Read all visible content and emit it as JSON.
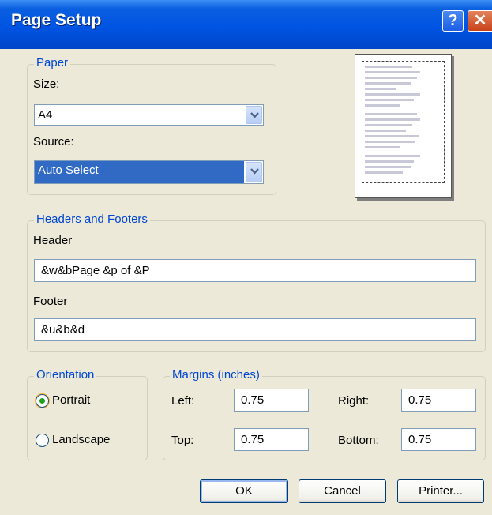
{
  "dialog": {
    "title": "Page Setup",
    "help_glyph": "?",
    "close_glyph": "✕"
  },
  "paper": {
    "legend": "Paper",
    "size_label": "Size:",
    "size_value": "A4",
    "source_label": "Source:",
    "source_value": "Auto Select"
  },
  "headers_footers": {
    "legend": "Headers and Footers",
    "header_label": "Header",
    "header_value": "&w&bPage &p of &P",
    "footer_label": "Footer",
    "footer_value": "&u&b&d"
  },
  "orientation": {
    "legend": "Orientation",
    "portrait_label": "Portrait",
    "landscape_label": "Landscape",
    "selected": "Portrait"
  },
  "margins": {
    "legend": "Margins (inches)",
    "left_label": "Left:",
    "left_value": "0.75",
    "right_label": "Right:",
    "right_value": "0.75",
    "top_label": "Top:",
    "top_value": "0.75",
    "bottom_label": "Bottom:",
    "bottom_value": "0.75"
  },
  "buttons": {
    "ok": "OK",
    "cancel": "Cancel",
    "printer": "Printer..."
  },
  "colors": {
    "titlebar": "#0054e3",
    "legend_text": "#0046d5",
    "selection": "#316ac5"
  }
}
